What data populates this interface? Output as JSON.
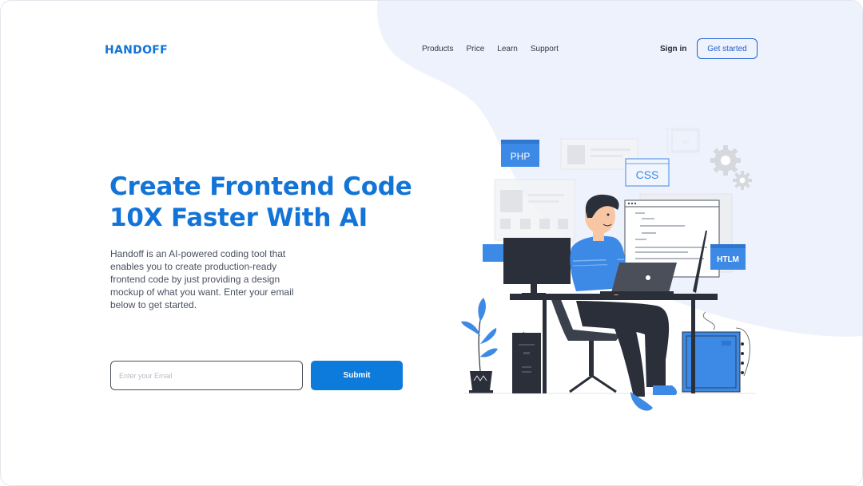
{
  "brand": {
    "name": "HANDOFF",
    "color": "#1374d8"
  },
  "nav": {
    "items": [
      {
        "label": "Products"
      },
      {
        "label": "Price"
      },
      {
        "label": "Learn"
      },
      {
        "label": "Support"
      }
    ],
    "sign_in": "Sign in",
    "get_started": "Get started"
  },
  "hero": {
    "headline_line1": "Create Frontend Code",
    "headline_line2": "10X Faster With AI",
    "description": "Handoff is an AI-powered coding tool that enables you to create production-ready frontend code by just providing a design mockup of what you want. Enter your email below to get started."
  },
  "signup": {
    "email_placeholder": "Enter your Email",
    "email_value": "",
    "submit_label": "Submit"
  },
  "illustration": {
    "tags": {
      "php": "PHP",
      "css": "CSS",
      "html": "HTLM"
    },
    "icons": [
      "gear-icon",
      "plant-icon",
      "monitor-icon",
      "laptop-icon",
      "cpu-tower-icon"
    ]
  },
  "colors": {
    "accent": "#1374d8",
    "button": "#0c7bdc",
    "background_blob": "#eef2fc",
    "illustration_blue": "#3d8ae6"
  }
}
